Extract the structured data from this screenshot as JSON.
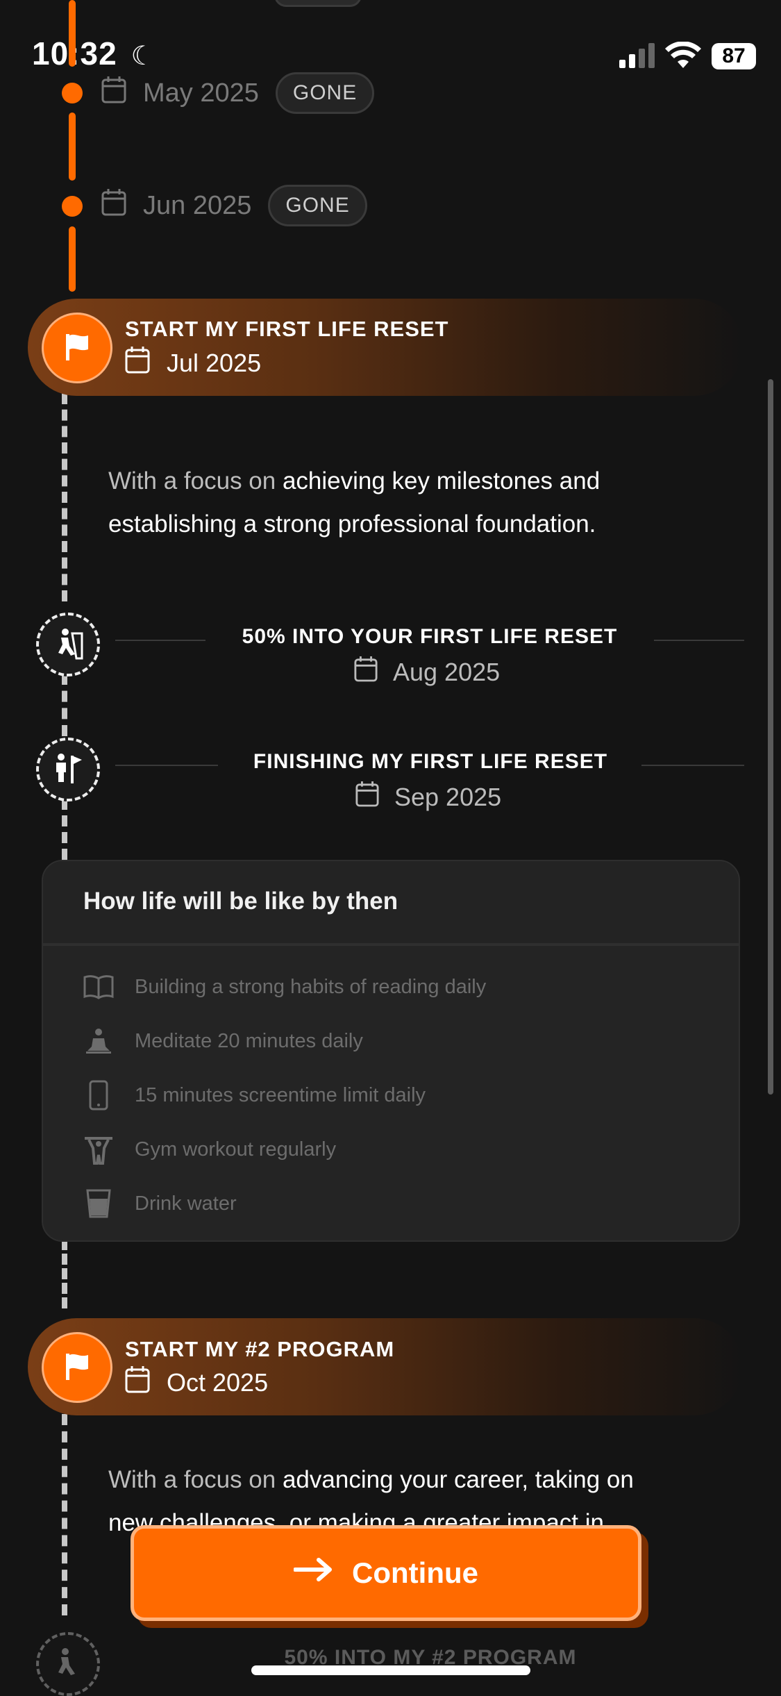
{
  "status": {
    "time": "10:32",
    "battery": "87"
  },
  "past": [
    {
      "month": "May 2025",
      "badge": "GONE"
    },
    {
      "month": "Jun 2025",
      "badge": "GONE"
    }
  ],
  "program1": {
    "title": "START MY FIRST LIFE RESET",
    "date": "Jul 2025",
    "desc_prefix": "With a focus on ",
    "desc_bold": "achieving key milestones and establishing a strong professional foundation."
  },
  "milestones": [
    {
      "title": "50% INTO YOUR FIRST LIFE RESET",
      "date": "Aug 2025"
    },
    {
      "title": "FINISHING MY FIRST LIFE RESET",
      "date": "Sep 2025"
    }
  ],
  "card": {
    "title": "How life will be like by then",
    "habits": [
      {
        "icon": "book-icon",
        "text": "Building a strong habits of reading daily"
      },
      {
        "icon": "meditation-icon",
        "text": "Meditate 20 minutes daily"
      },
      {
        "icon": "phone-icon",
        "text": "15 minutes screentime limit daily"
      },
      {
        "icon": "weightlifting-icon",
        "text": "Gym workout regularly"
      },
      {
        "icon": "water-glass-icon",
        "text": "Drink water"
      }
    ]
  },
  "program2": {
    "title": "START MY #2 PROGRAM",
    "date": "Oct 2025",
    "desc_prefix": "With a focus on ",
    "desc_bold": "advancing your career, taking on new challenges, or making a greater impact in"
  },
  "milestone3": {
    "title": "50% INTO MY #2 PROGRAM"
  },
  "cta": {
    "label": "Continue"
  },
  "colors": {
    "accent": "#ff6a00",
    "background": "#141414"
  }
}
